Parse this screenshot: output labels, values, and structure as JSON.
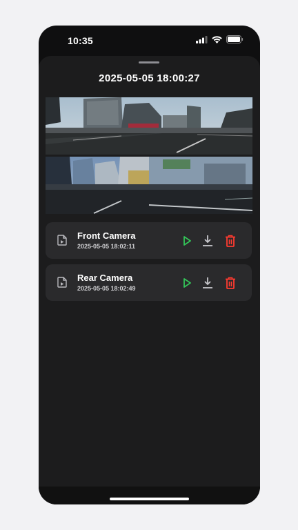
{
  "status_bar": {
    "time": "10:35"
  },
  "sheet": {
    "title": "2025-05-05 18:00:27"
  },
  "files": [
    {
      "name": "Front Camera",
      "timestamp": "2025-05-05 18:02:11"
    },
    {
      "name": "Rear Camera",
      "timestamp": "2025-05-05 18:02:49"
    }
  ],
  "colors": {
    "play": "#34c759",
    "download": "#c7c7cc",
    "delete": "#ff3b30"
  },
  "icons": [
    "video-file-icon",
    "play-icon",
    "download-icon",
    "trash-icon"
  ]
}
